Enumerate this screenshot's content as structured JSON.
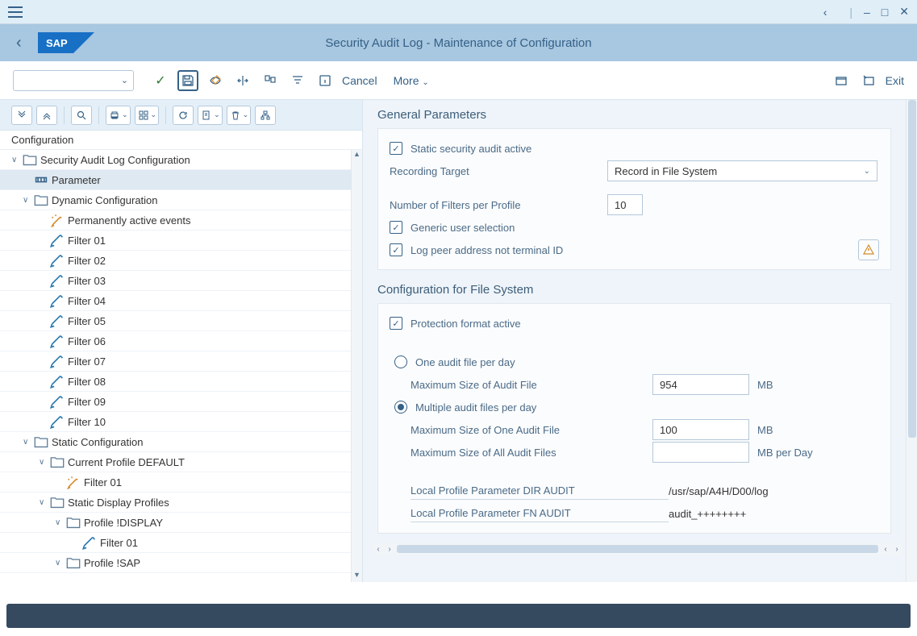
{
  "page_title": "Security Audit Log - Maintenance of Configuration",
  "toolbar": {
    "cancel": "Cancel",
    "more": "More",
    "exit": "Exit"
  },
  "tree": {
    "header": "Configuration",
    "root": "Security Audit Log Configuration",
    "parameter": "Parameter",
    "dynamic": "Dynamic Configuration",
    "perm_active": "Permanently active events",
    "filters": [
      "Filter 01",
      "Filter 02",
      "Filter 03",
      "Filter 04",
      "Filter 05",
      "Filter 06",
      "Filter 07",
      "Filter 08",
      "Filter 09",
      "Filter 10"
    ],
    "static": "Static Configuration",
    "current_profile": "Current Profile DEFAULT",
    "cp_filter": "Filter 01",
    "static_display": "Static Display Profiles",
    "profile_display": "Profile !DISPLAY",
    "pd_filter": "Filter 01",
    "profile_sap": "Profile !SAP"
  },
  "general": {
    "title": "General Parameters",
    "static_active": "Static security audit active",
    "recording_target_label": "Recording Target",
    "recording_target_value": "Record in File System",
    "num_filters_label": "Number of Filters per Profile",
    "num_filters_value": "10",
    "generic_user": "Generic user selection",
    "log_peer": "Log peer address not terminal ID"
  },
  "filesys": {
    "title": "Configuration for File System",
    "protection": "Protection format active",
    "one_per_day": "One audit file per day",
    "max_audit_label": "Maximum Size of Audit File",
    "max_audit_value": "954",
    "mb": "MB",
    "multi_per_day": "Multiple audit files per day",
    "max_one_label": "Maximum Size of One Audit File",
    "max_one_value": "100",
    "max_all_label": "Maximum Size of All Audit Files",
    "max_all_value": "",
    "mb_per_day": "MB per Day",
    "dir_audit_label": "Local Profile Parameter DIR AUDIT",
    "dir_audit_value": "/usr/sap/A4H/D00/log",
    "fn_audit_label": "Local Profile Parameter FN AUDIT",
    "fn_audit_value": "audit_++++++++"
  }
}
